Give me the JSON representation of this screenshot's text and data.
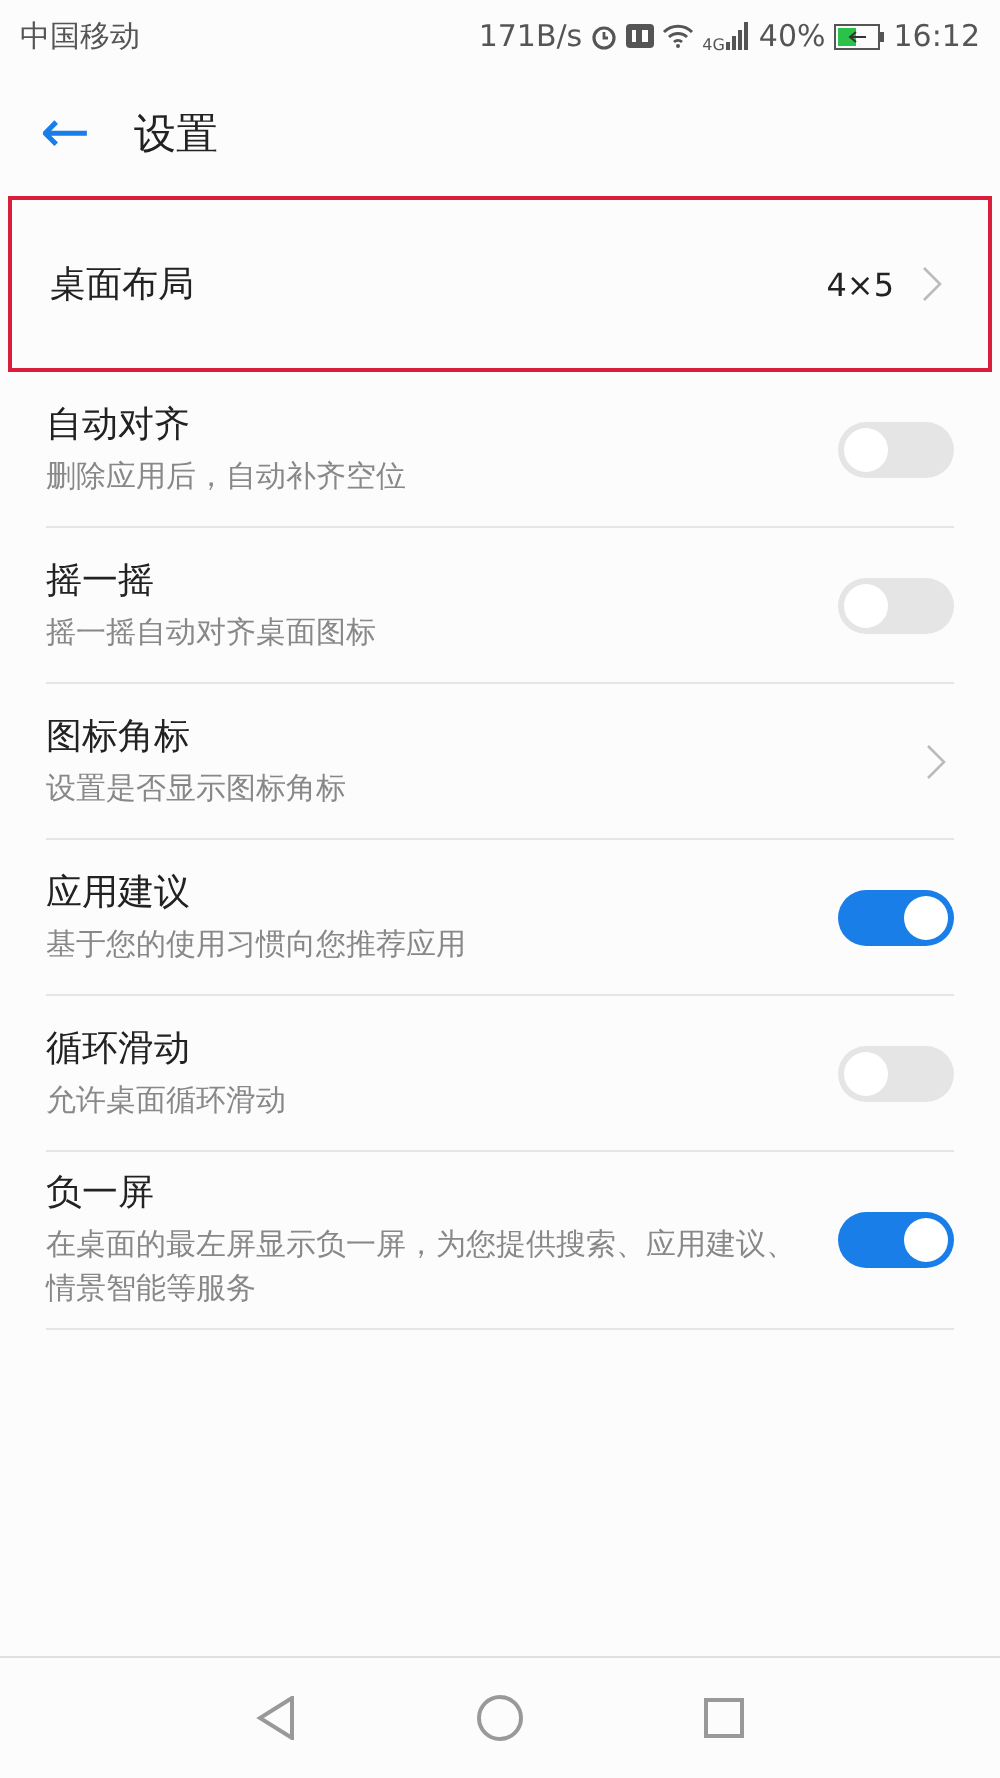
{
  "status_bar": {
    "carrier": "中国移动",
    "speed": "171B/s",
    "network": "4G",
    "battery": "40%",
    "time": "16:12"
  },
  "header": {
    "back": "←",
    "title": "设置"
  },
  "rows": [
    {
      "kind": "link",
      "title": "桌面布局",
      "value": "4×5",
      "highlighted": true
    },
    {
      "kind": "toggle",
      "title": "自动对齐",
      "subtitle": "删除应用后，自动补齐空位",
      "on": false
    },
    {
      "kind": "toggle",
      "title": "摇一摇",
      "subtitle": "摇一摇自动对齐桌面图标",
      "on": false
    },
    {
      "kind": "link",
      "title": "图标角标",
      "subtitle": "设置是否显示图标角标",
      "highlighted": false
    },
    {
      "kind": "toggle",
      "title": "应用建议",
      "subtitle": "基于您的使用习惯向您推荐应用",
      "on": true
    },
    {
      "kind": "toggle",
      "title": "循环滑动",
      "subtitle": "允许桌面循环滑动",
      "on": false
    },
    {
      "kind": "toggle",
      "title": "负一屏",
      "subtitle": "在桌面的最左屏显示负一屏，为您提供搜索、应用建议、情景智能等服务",
      "on": true
    }
  ]
}
